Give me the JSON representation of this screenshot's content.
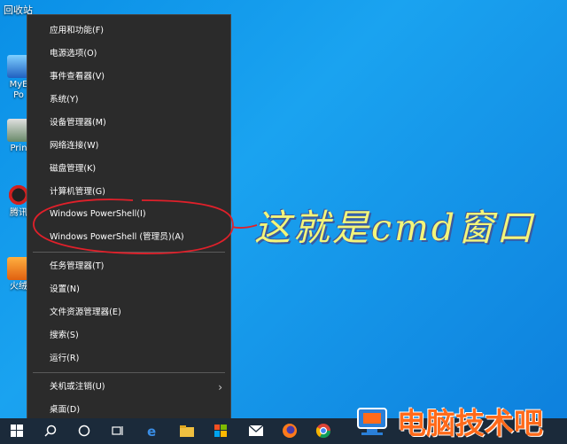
{
  "desktop": {
    "recycle_bin": "回收站",
    "icons": [
      "MyE Po",
      "Prin",
      "腾讯",
      "火绒"
    ]
  },
  "menu": {
    "items": [
      {
        "label": "应用和功能(F)"
      },
      {
        "label": "电源选项(O)"
      },
      {
        "label": "事件查看器(V)"
      },
      {
        "label": "系统(Y)"
      },
      {
        "label": "设备管理器(M)"
      },
      {
        "label": "网络连接(W)"
      },
      {
        "label": "磁盘管理(K)"
      },
      {
        "label": "计算机管理(G)"
      },
      {
        "label": "Windows PowerShell(I)"
      },
      {
        "label": "Windows PowerShell (管理员)(A)"
      },
      {
        "label": "任务管理器(T)"
      },
      {
        "label": "设置(N)"
      },
      {
        "label": "文件资源管理器(E)"
      },
      {
        "label": "搜索(S)"
      },
      {
        "label": "运行(R)"
      },
      {
        "label": "关机或注销(U)"
      },
      {
        "label": "桌面(D)"
      }
    ],
    "submenu_icon": "chevron-right-icon"
  },
  "annotation": {
    "text": "这就是cmd窗口",
    "color": "#f3f57a",
    "circle_color": "#e0202a"
  },
  "watermark": {
    "text": "电脑技术吧",
    "color": "#ff6a1a"
  },
  "taskbar": {
    "icons": [
      "windows-start-icon",
      "search-icon",
      "cortana-icon",
      "task-view-icon",
      "edge-icon",
      "file-explorer-icon",
      "store-icon",
      "start-tiles-icon",
      "mail-icon",
      "firefox-icon",
      "chrome-icon"
    ]
  }
}
